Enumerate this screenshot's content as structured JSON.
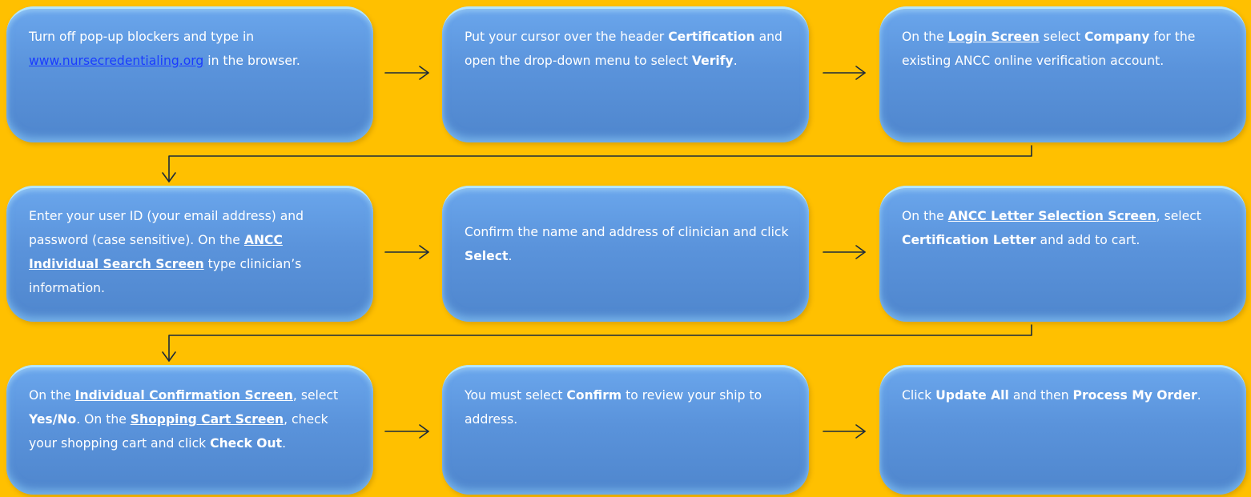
{
  "steps": {
    "s1": {
      "t1": "Turn off pop-up blockers and type in",
      "link": "www.nursecredentialing.org",
      "t2": " in the browser."
    },
    "s2": {
      "t1": "Put your cursor over the header ",
      "b1": "Certification",
      "t2": " and open the drop-down menu to select ",
      "b2": "Verify",
      "t3": "."
    },
    "s3": {
      "t1": "On the ",
      "u1": "Login Screen",
      "t2": " select ",
      "b1": "Company",
      "t3": " for the existing ANCC online verification account."
    },
    "s4": {
      "t1": "Enter your user ID (your email address) and password (case sensitive). On the ",
      "u1": "ANCC Individual Search Screen",
      "t2": " type clinician’s information."
    },
    "s5": {
      "t1": "Confirm the name and address of clinician and click ",
      "b1": "Select",
      "t2": "."
    },
    "s6": {
      "t1": "On the ",
      "u1": "ANCC Letter Selection Screen",
      "t2": ", select ",
      "b1": "Certification Letter",
      "t3": " and add to cart."
    },
    "s7": {
      "t1": "On the ",
      "u1": "Individual Confirmation Screen",
      "t2": ", select ",
      "b1": "Yes/No",
      "t3": ". On the ",
      "u2": "Shopping Cart Screen",
      "t4": ", check your shopping cart and click ",
      "b2": "Check Out",
      "t5": "."
    },
    "s8": {
      "t1": "You must select ",
      "b1": "Confirm",
      "t2": " to review your ship to address."
    },
    "s9": {
      "t1": "Click ",
      "b1": "Update All",
      "t2": " and then ",
      "b2": "Process My Order",
      "t3": "."
    }
  },
  "colors": {
    "background": "#FFC000",
    "box_fill": "#5a93db",
    "box_highlight": "#b4e6ff",
    "text": "#ffffff",
    "link": "#1a3cff",
    "arrow": "#1c2a3a"
  },
  "icons": {
    "flow_arrow": "right-arrow-icon",
    "wrap_connector": "down-arrow-icon"
  }
}
